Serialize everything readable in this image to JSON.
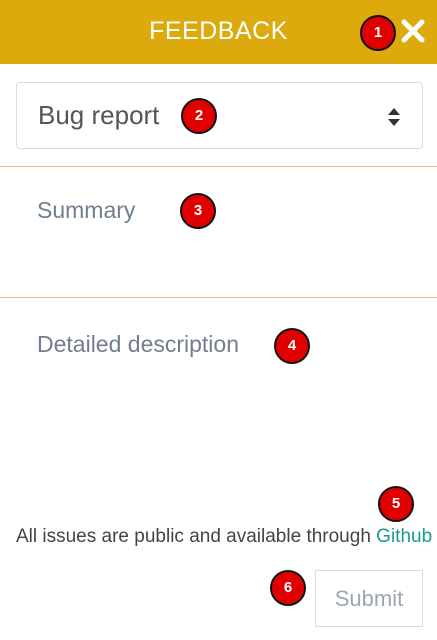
{
  "header": {
    "title": "FEEDBACK",
    "close_icon": "close-icon"
  },
  "form": {
    "type_select": {
      "value": "Bug report",
      "caret_icon": "sort-caret-icon"
    },
    "summary": {
      "placeholder": "Summary"
    },
    "description": {
      "placeholder": "Detailed description"
    },
    "notice": {
      "text": "All issues are public and available through ",
      "link_label": "Github"
    },
    "submit_label": "Submit"
  },
  "markers": [
    "1",
    "2",
    "3",
    "4",
    "5",
    "6"
  ],
  "colors": {
    "header_bg": "#dcaa0c",
    "link": "#1a9c8c",
    "marker_bg": "#e00000"
  }
}
